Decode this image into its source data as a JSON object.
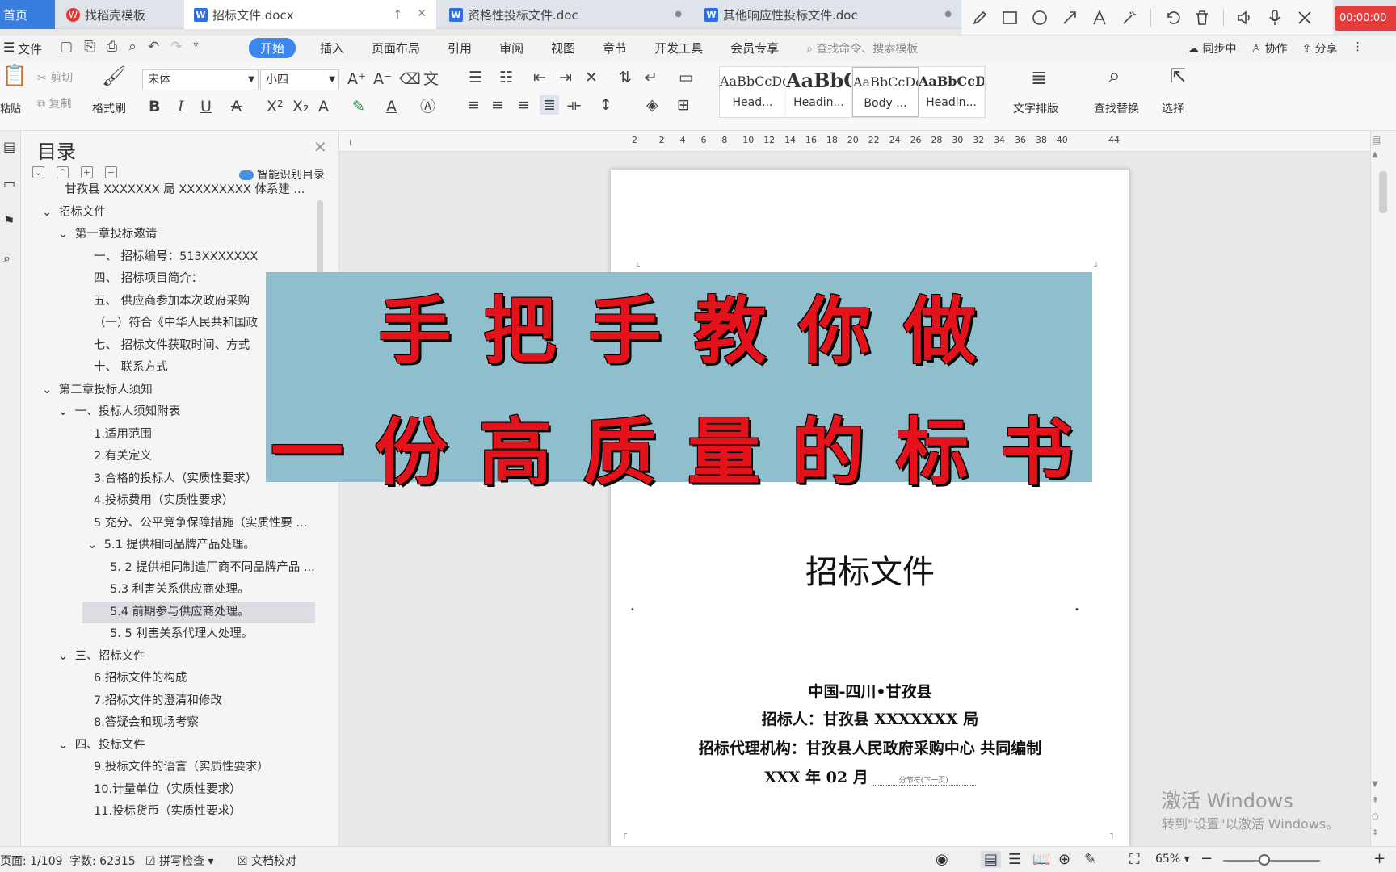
{
  "tabs": {
    "home": "首页",
    "templates": "找稻壳模板",
    "active_doc": "招标文件.docx",
    "doc2": "资格性投标文件.doc",
    "doc3": "其他响应性投标文件.doc"
  },
  "recording": {
    "timer": "00:00:00"
  },
  "menu": {
    "file": "文件",
    "start": "开始",
    "insert": "插入",
    "layout": "页面布局",
    "reference": "引用",
    "review": "审阅",
    "view": "视图",
    "chapter": "章节",
    "devtools": "开发工具",
    "member": "会员专享",
    "search_placeholder": "查找命令、搜索模板",
    "sync": "同步中",
    "collab": "协作",
    "share": "分享"
  },
  "ribbon": {
    "paste": "粘贴",
    "cut": "剪切",
    "copy": "复制",
    "format_painter": "格式刷",
    "font": "宋体",
    "font_size": "小四",
    "styles": [
      {
        "preview": "AaBbCcDd",
        "name": "Head..."
      },
      {
        "preview": "AaBbC",
        "name": "Headin..."
      },
      {
        "preview": "AaBbCcDc",
        "name": "Body ..."
      },
      {
        "preview": "AaBbCcDc",
        "name": "Headin..."
      }
    ],
    "text_layout": "文字排版",
    "find_replace": "查找替换",
    "select": "选择"
  },
  "toc": {
    "title": "目录",
    "smart": "智能识别目录",
    "items": [
      {
        "text": "甘孜县 XXXXXXX 局 XXXXXXXXX 体系建 ...",
        "indent": 0,
        "arrow": ""
      },
      {
        "text": "招标文件",
        "indent": 1,
        "arrow": "down"
      },
      {
        "text": "第一章投标邀请",
        "indent": 2,
        "arrow": "down"
      },
      {
        "text": "一、  招标编号：513XXXXXXX",
        "indent": 3,
        "arrow": ""
      },
      {
        "text": "四、  招标项目简介：",
        "indent": 3,
        "arrow": ""
      },
      {
        "text": "五、  供应商参加本次政府采购",
        "indent": 3,
        "arrow": ""
      },
      {
        "text": "（一）符合《中华人民共和国政",
        "indent": 3,
        "arrow": ""
      },
      {
        "text": "七、  招标文件获取时间、方式",
        "indent": 3,
        "arrow": ""
      },
      {
        "text": "十、  联系方式",
        "indent": 3,
        "arrow": ""
      },
      {
        "text": "第二章投标人须知",
        "indent": 1,
        "arrow": "down"
      },
      {
        "text": "一、投标人须知附表",
        "indent": 2,
        "arrow": "down"
      },
      {
        "text": "1.适用范围",
        "indent": 3,
        "arrow": ""
      },
      {
        "text": "2.有关定义",
        "indent": 3,
        "arrow": ""
      },
      {
        "text": "3.合格的投标人（实质性要求）",
        "indent": 3,
        "arrow": ""
      },
      {
        "text": "4.投标费用（实质性要求）",
        "indent": 3,
        "arrow": ""
      },
      {
        "text": "5.充分、公平竞争保障措施（实质性要 ...",
        "indent": 3,
        "arrow": ""
      },
      {
        "text": "5.1 提供相同品牌产品处理。",
        "indent": 3,
        "arrow": "down"
      },
      {
        "text": "5. 2 提供相同制造厂商不同品牌产品 ...",
        "indent": 4,
        "arrow": ""
      },
      {
        "text": "5.3 利害关系供应商处理。",
        "indent": 4,
        "arrow": ""
      },
      {
        "text": "5.4 前期参与供应商处理。",
        "indent": 4,
        "arrow": "",
        "selected": true
      },
      {
        "text": "5. 5 利害关系代理人处理。",
        "indent": 4,
        "arrow": ""
      },
      {
        "text": "三、招标文件",
        "indent": 2,
        "arrow": "down"
      },
      {
        "text": "6.招标文件的构成",
        "indent": 3,
        "arrow": ""
      },
      {
        "text": "7.招标文件的澄清和修改",
        "indent": 3,
        "arrow": ""
      },
      {
        "text": "8.答疑会和现场考察",
        "indent": 3,
        "arrow": ""
      },
      {
        "text": "四、投标文件",
        "indent": 2,
        "arrow": "down"
      },
      {
        "text": "9.投标文件的语言（实质性要求）",
        "indent": 3,
        "arrow": ""
      },
      {
        "text": "10.计量单位（实质性要求）",
        "indent": 3,
        "arrow": ""
      },
      {
        "text": "11.投标货币（实质性要求）",
        "indent": 3,
        "arrow": ""
      }
    ]
  },
  "ruler": {
    "ticks": [
      "2",
      "2",
      "4",
      "6",
      "8",
      "10",
      "12",
      "14",
      "16",
      "18",
      "20",
      "22",
      "24",
      "26",
      "28",
      "30",
      "32",
      "34",
      "36",
      "38",
      "40",
      "44"
    ]
  },
  "document": {
    "title": "招标文件",
    "line1": "中国-四川•甘孜县",
    "line2": "招标人：甘孜县 XXXXXXX 局",
    "line3": "招标代理机构：甘孜县人民政府采购中心 共同编制",
    "line4": "XXX 年 02 月",
    "section_break": "分节符(下一页)"
  },
  "banner": {
    "line1": "手把手教你做",
    "line2": "一份高质量的标书",
    "bg": "#8fbfcc",
    "text_color": "#e4131b"
  },
  "watermark": {
    "line1": "激活 Windows",
    "line2": "转到\"设置\"以激活 Windows。"
  },
  "status": {
    "page": "页面: 1/109",
    "words": "字数: 62315",
    "spell": "拼写检查",
    "doc_check": "文档校对",
    "zoom": "65%"
  }
}
